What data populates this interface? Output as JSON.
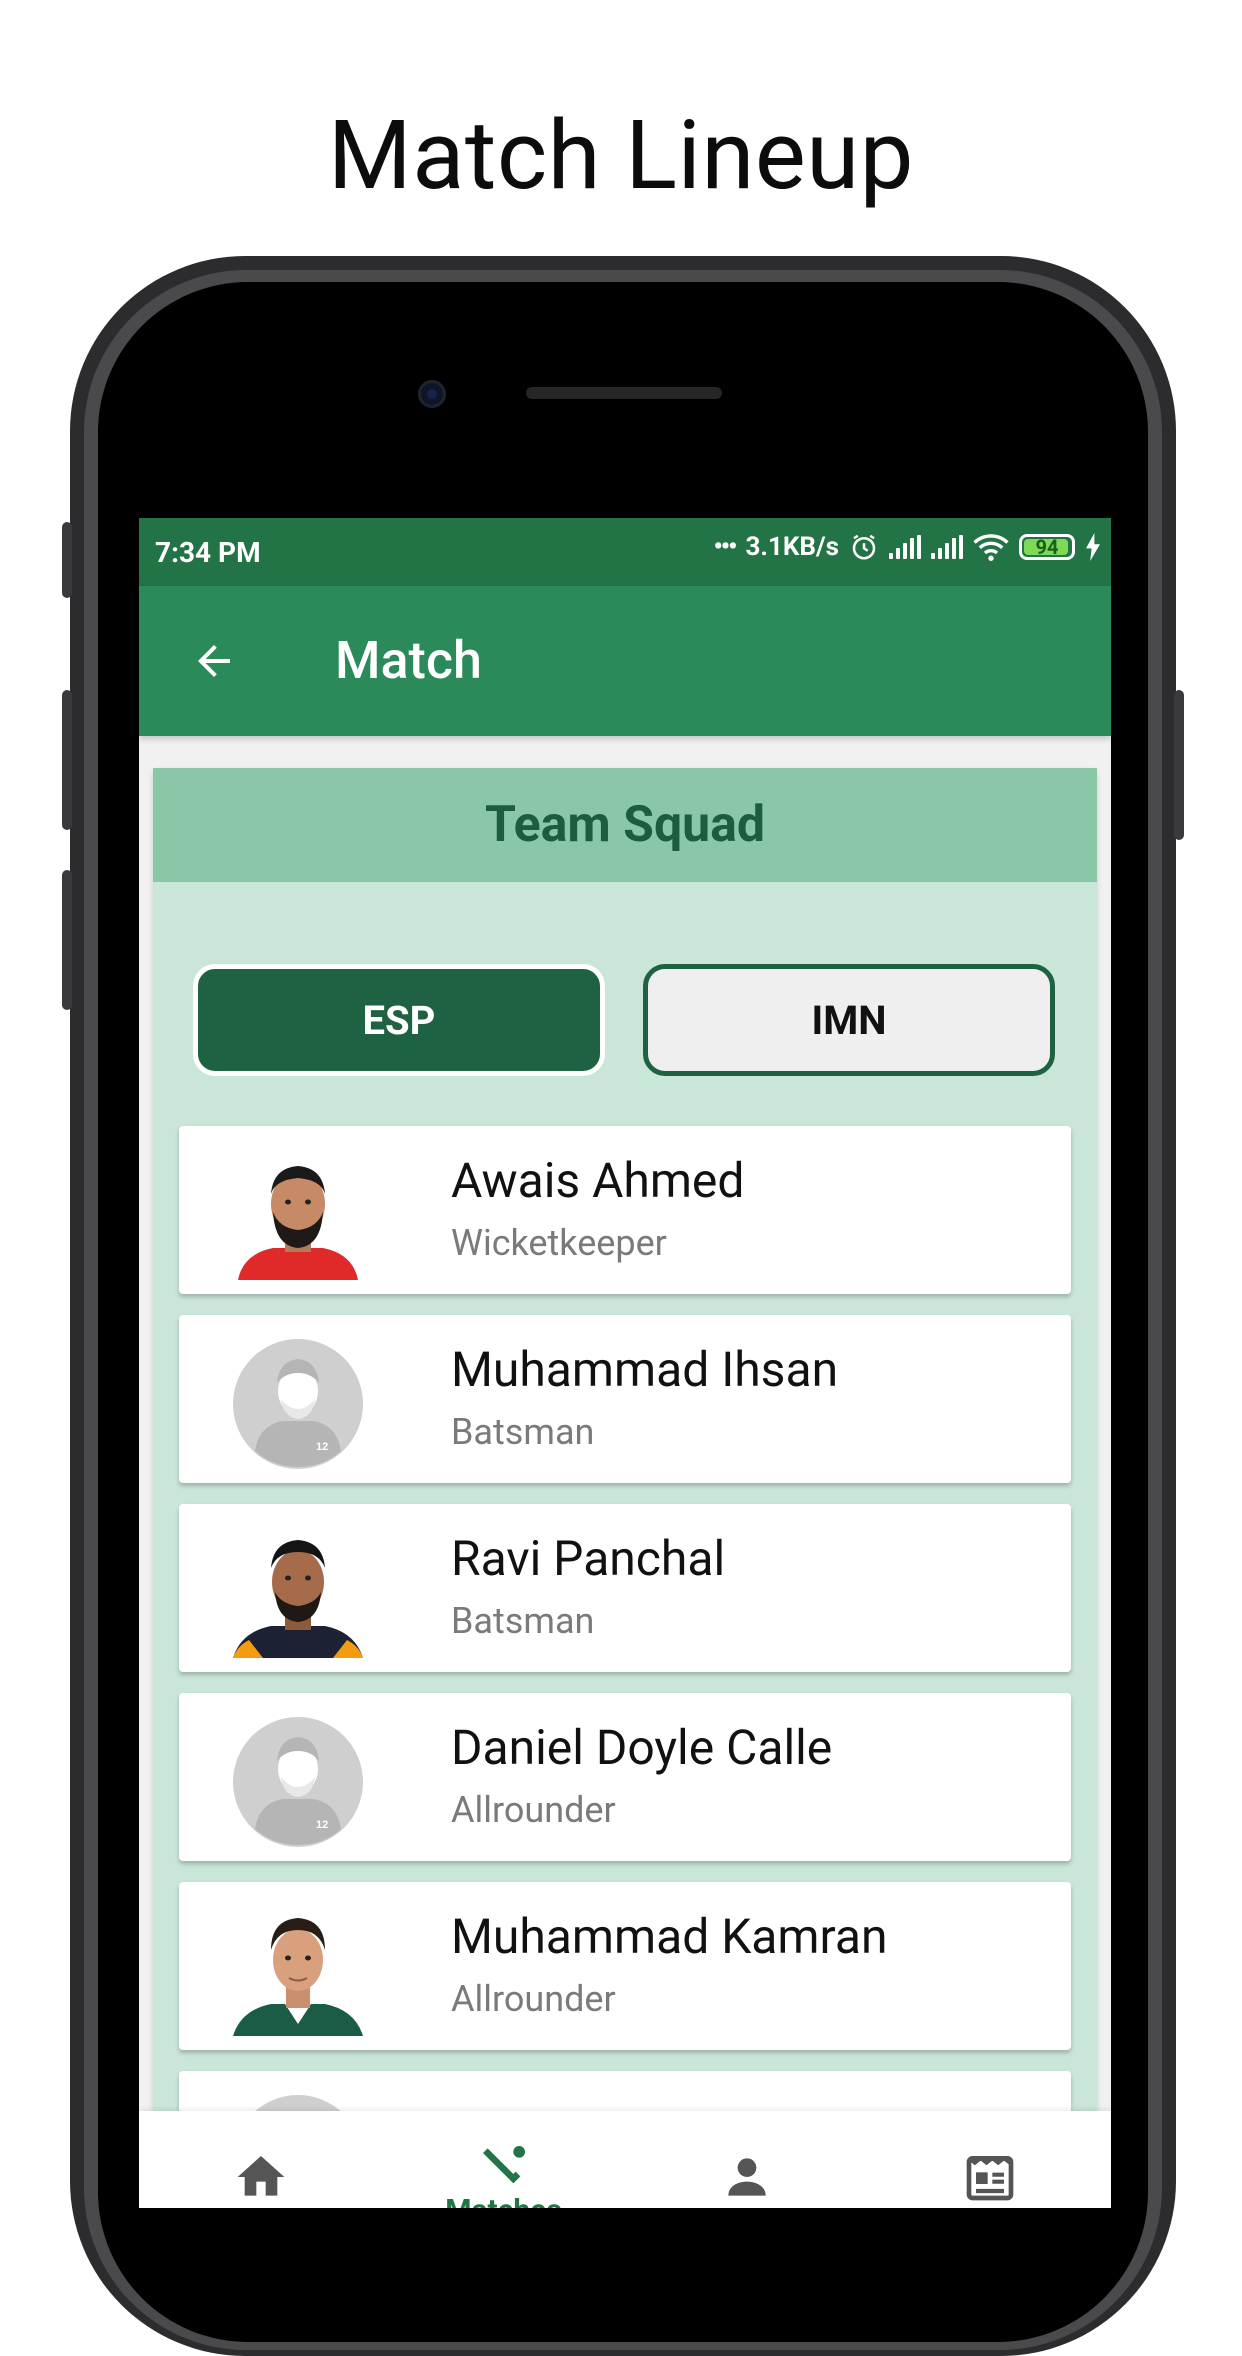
{
  "page_title": "Match Lineup",
  "status_bar": {
    "time": "7:34 PM",
    "speed": "3.1KB/s",
    "battery": "94"
  },
  "app_bar": {
    "title": "Match"
  },
  "squad": {
    "header": "Team Squad",
    "teams": [
      {
        "label": "ESP",
        "selected": true
      },
      {
        "label": "IMN",
        "selected": false
      }
    ],
    "players": [
      {
        "name": "Awais Ahmed",
        "role": "Wicketkeeper",
        "avatar": "photo-a"
      },
      {
        "name": "Muhammad Ihsan",
        "role": "Batsman",
        "avatar": "placeholder"
      },
      {
        "name": "Ravi Panchal",
        "role": "Batsman",
        "avatar": "photo-b"
      },
      {
        "name": "Daniel Doyle Calle",
        "role": "Allrounder",
        "avatar": "placeholder"
      },
      {
        "name": "Muhammad Kamran",
        "role": "Allrounder",
        "avatar": "photo-c"
      }
    ]
  },
  "bottom_nav": {
    "items": [
      {
        "icon": "home-icon",
        "label": ""
      },
      {
        "icon": "cricket-icon",
        "label": "Matches",
        "active": true
      },
      {
        "icon": "person-icon",
        "label": ""
      },
      {
        "icon": "news-icon",
        "label": ""
      }
    ]
  },
  "colors": {
    "primary": "#2a8a5a",
    "status_bar": "#227345",
    "card_bg": "#c9e6d8",
    "card_header": "#89c7a7",
    "team_active": "#1e6242"
  }
}
